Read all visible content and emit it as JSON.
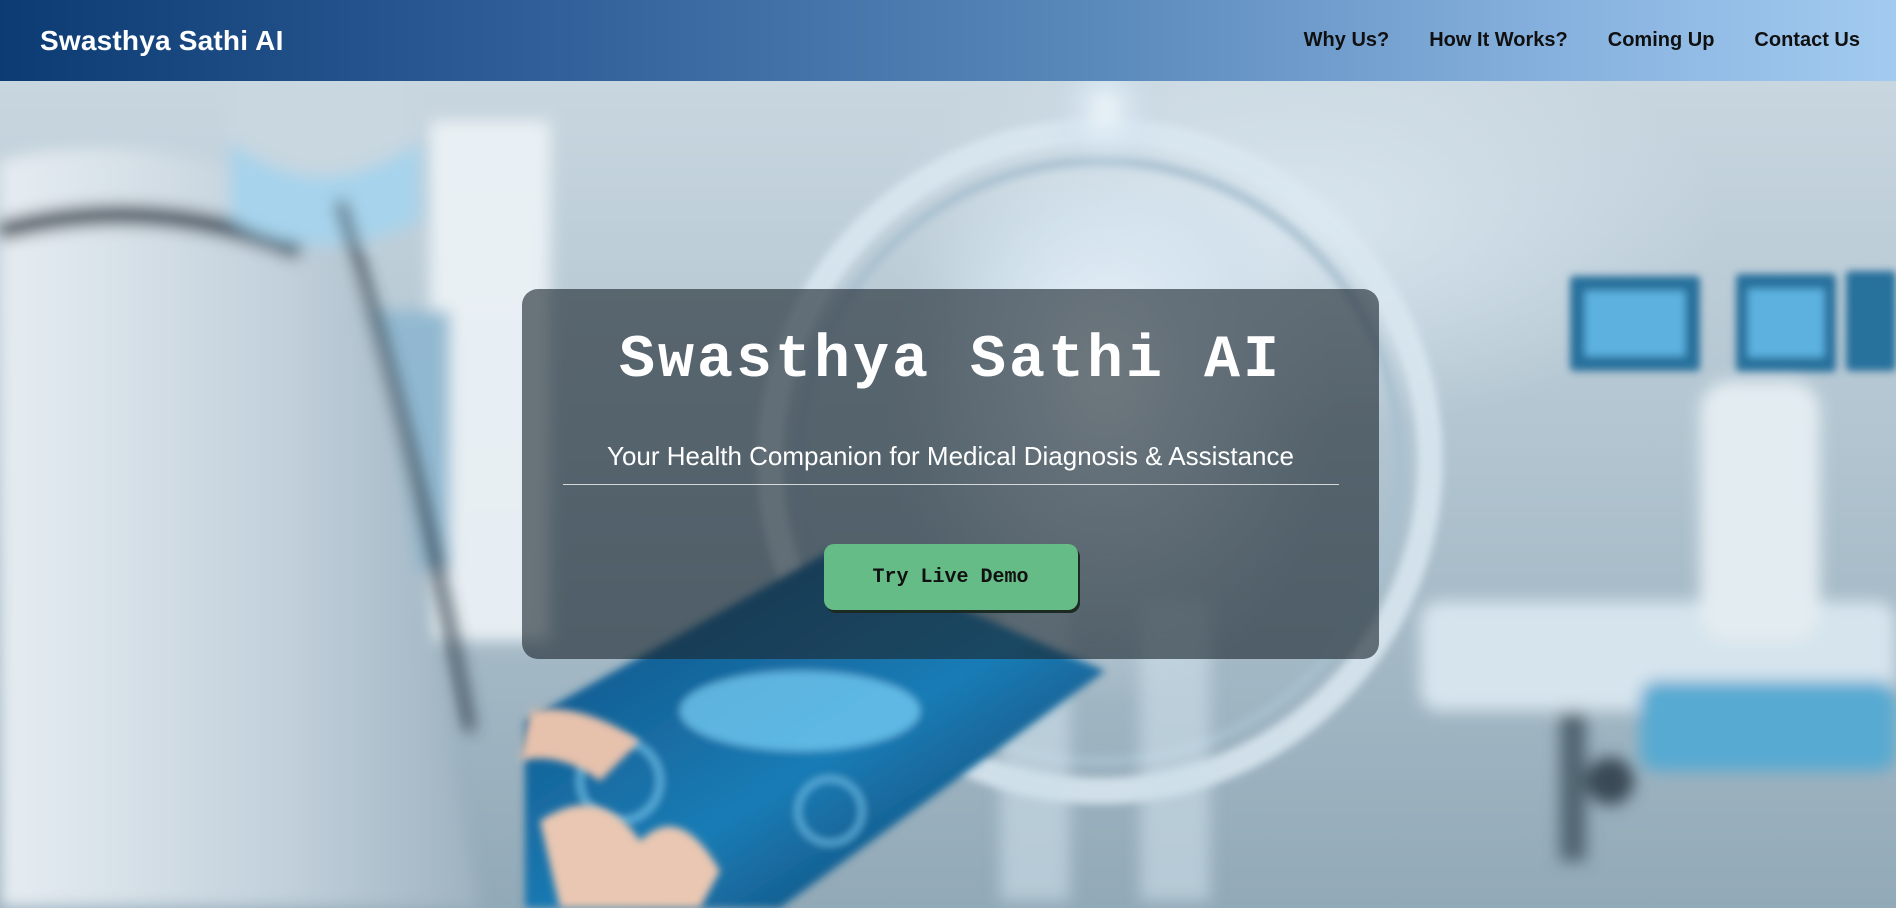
{
  "header": {
    "brand": "Swasthya Sathi AI",
    "nav": [
      {
        "label": "Why Us?"
      },
      {
        "label": "How It Works?"
      },
      {
        "label": "Coming Up"
      },
      {
        "label": "Contact Us"
      }
    ]
  },
  "hero": {
    "title": "Swasthya Sathi AI",
    "subtitle": "Your Health Companion for Medical Diagnosis & Assistance",
    "cta_label": "Try Live Demo"
  },
  "colors": {
    "nav_gradient_start": "#0c3b73",
    "nav_gradient_end": "#a3cbf0",
    "cta_background": "#66bc87",
    "card_background": "rgba(28, 38, 46, 0.62)"
  }
}
